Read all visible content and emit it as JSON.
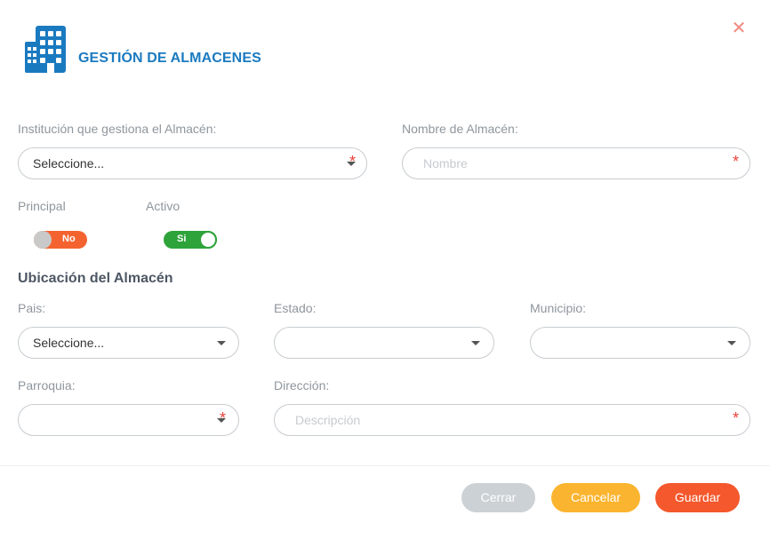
{
  "header": {
    "title": "GESTIÓN DE ALMACENES",
    "icon": "building-icon",
    "close_symbol": "✕",
    "accent_color": "#1a7ac0"
  },
  "form": {
    "institution": {
      "label": "Institución que gestiona el Almacén:",
      "value": "Seleccione...",
      "required": true
    },
    "warehouse_name": {
      "label": "Nombre de Almacén:",
      "placeholder": "Nombre",
      "value": "",
      "required": true
    },
    "principal": {
      "label": "Principal",
      "state": "No",
      "on": false
    },
    "activo": {
      "label": "Activo",
      "state": "Si",
      "on": true
    },
    "location": {
      "title": "Ubicación del Almacén",
      "pais": {
        "label": "Pais:",
        "value": "Seleccione..."
      },
      "estado": {
        "label": "Estado:",
        "value": ""
      },
      "municipio": {
        "label": "Municipio:",
        "value": ""
      },
      "parroquia": {
        "label": "Parroquia:",
        "value": "",
        "required": true
      },
      "direccion": {
        "label": "Dirección:",
        "placeholder": "Descripción",
        "value": "",
        "required": true
      }
    },
    "required_marker": "*"
  },
  "footer": {
    "close_label": "Cerrar",
    "cancel_label": "Cancelar",
    "save_label": "Guardar"
  }
}
